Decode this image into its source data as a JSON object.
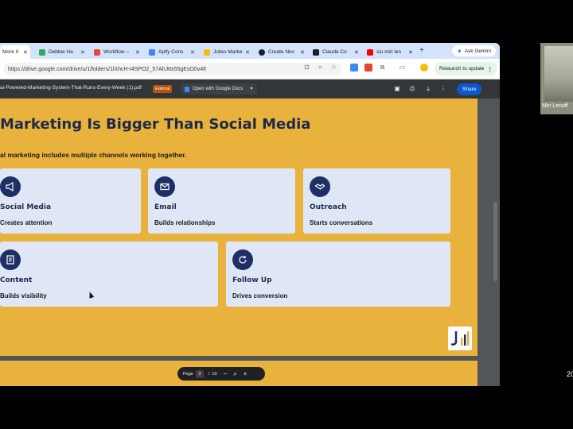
{
  "tabs": [
    {
      "label": "More II",
      "color": "#5f6368",
      "active": true
    },
    {
      "label": "Debbie Ha",
      "color": "#34a853"
    },
    {
      "label": "Workflow –",
      "color": "#ea4335"
    },
    {
      "label": "Apify Cons",
      "color": "#4285f4"
    },
    {
      "label": "Jolies Marke",
      "color": "#fbbc04"
    },
    {
      "label": "Create Nev",
      "color": "#202124"
    },
    {
      "label": "Claude Co",
      "color": "#202124"
    },
    {
      "label": "siu miri len",
      "color": "#ff0000"
    }
  ],
  "browser": {
    "url": "https://drive.google.com/drive/u/1/folders/1lXhcH-I4SPO2_57AhJttx55gEsO0v4fr",
    "ask_gemini": "Ask Gemini",
    "relaunch": "Relaunch to update"
  },
  "viewer": {
    "filename": "ai-Powered-Marketing-System-That-Runs-Every-Week (1).pdf",
    "external": "External",
    "open_with": "Open with Google Docs",
    "share": "Share"
  },
  "slide": {
    "title": "Marketing Is Bigger Than Social Media",
    "subtitle": "al marketing includes multiple channels working together.",
    "cards": [
      {
        "title": "Social Media",
        "desc": "Creates attention",
        "icon": "megaphone-icon"
      },
      {
        "title": "Email",
        "desc": "Builds relationships",
        "icon": "envelope-icon"
      },
      {
        "title": "Outreach",
        "desc": "Starts conversations",
        "icon": "handshake-icon"
      },
      {
        "title": "Content",
        "desc": "Builds visibility",
        "icon": "document-icon"
      },
      {
        "title": "Follow Up",
        "desc": "Drives conversion",
        "icon": "refresh-icon"
      }
    ]
  },
  "pager": {
    "label": "Page",
    "current": "3",
    "separator": "/",
    "total": "10"
  },
  "participant": {
    "name": "Miri Lenoff"
  },
  "clock": "20"
}
